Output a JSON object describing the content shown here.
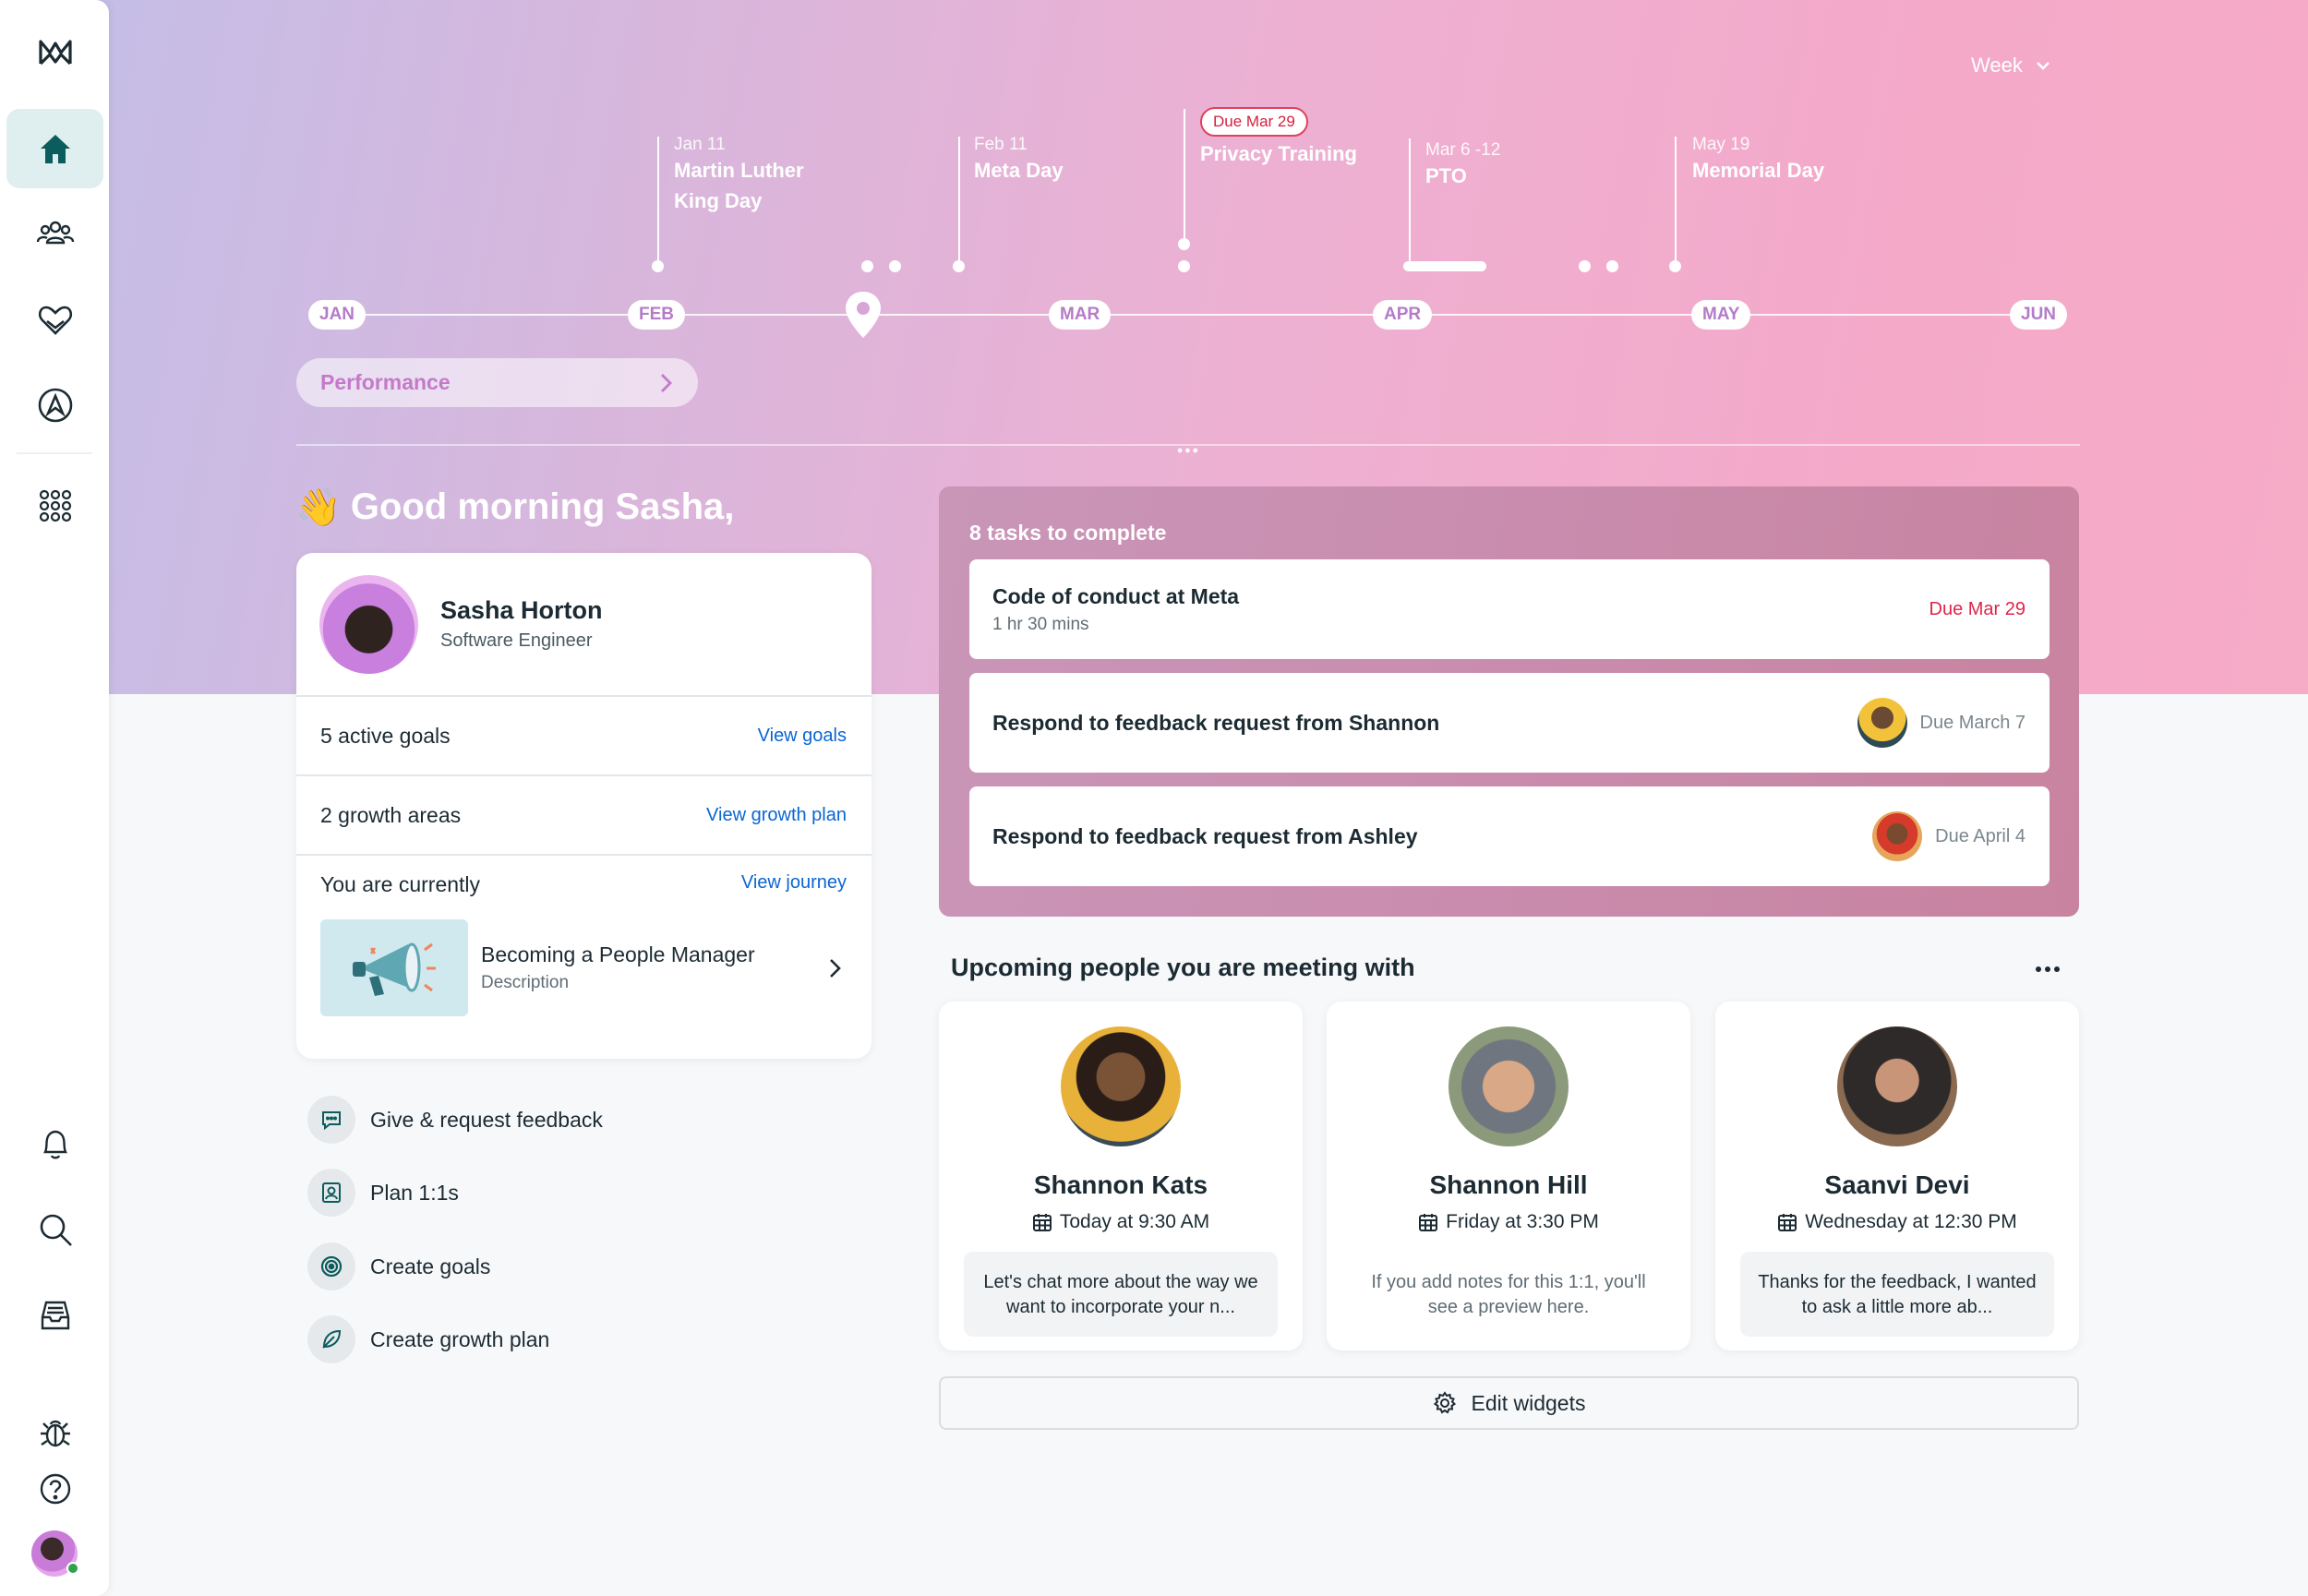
{
  "header": {
    "week_label": "Week"
  },
  "timeline": {
    "months": [
      "JAN",
      "FEB",
      "MAR",
      "APR",
      "MAY",
      "JUN"
    ],
    "events": [
      {
        "date": "Jan 11",
        "name": "Martin Luther King Day"
      },
      {
        "date": "Feb 11",
        "name": "Meta Day"
      },
      {
        "due": "Due Mar 29",
        "name": "Privacy Training"
      },
      {
        "date": "Mar 6 -12",
        "name": "PTO"
      },
      {
        "date": "May 19",
        "name": "Memorial Day"
      }
    ],
    "performance_label": "Performance"
  },
  "greeting": {
    "emoji": "👋",
    "text": "Good morning Sasha,"
  },
  "profile": {
    "name": "Sasha Horton",
    "role": "Software Engineer",
    "goals_text": "5 active goals",
    "goals_link": "View goals",
    "growth_text": "2 growth areas",
    "growth_link": "View growth plan",
    "journey_text": "You are currently",
    "journey_link": "View journey",
    "journey_title": "Becoming a People Manager",
    "journey_desc": "Description"
  },
  "quick_actions": [
    {
      "label": "Give & request feedback",
      "icon": "chat-icon"
    },
    {
      "label": "Plan 1:1s",
      "icon": "portrait-icon"
    },
    {
      "label": "Create goals",
      "icon": "target-icon"
    },
    {
      "label": "Create growth plan",
      "icon": "leaf-icon"
    }
  ],
  "tasks": {
    "title": "8 tasks to complete",
    "items": [
      {
        "title": "Code of conduct at Meta",
        "sub": "1 hr 30 mins",
        "due": "Due Mar 29"
      },
      {
        "title": "Respond to feedback request from Shannon",
        "due": "Due March 7"
      },
      {
        "title": "Respond to feedback request from Ashley",
        "due": "Due April 4"
      }
    ]
  },
  "upcoming": {
    "title": "Upcoming people you are meeting with",
    "people": [
      {
        "name": "Shannon Kats",
        "time": "Today at 9:30 AM",
        "note": "Let's chat more about the way we want to incorporate your n..."
      },
      {
        "name": "Shannon Hill",
        "time": "Friday at 3:30 PM",
        "note": "If you add notes for this 1:1, you'll see a preview here."
      },
      {
        "name": "Saanvi Devi",
        "time": "Wednesday at 12:30 PM",
        "note": "Thanks for the feedback, I wanted to ask a little more ab..."
      }
    ],
    "edit_label": "Edit widgets"
  },
  "colors": {
    "accent_teal": "#0b5c5c",
    "due_red": "#e0244a",
    "link_blue": "#0a66d2"
  }
}
